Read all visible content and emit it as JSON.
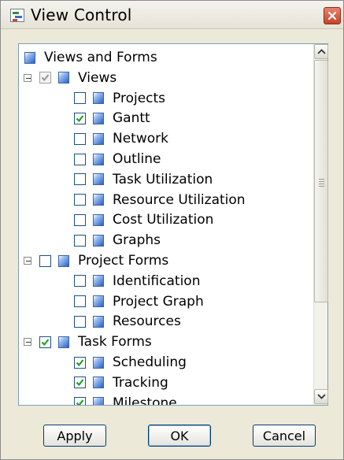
{
  "window": {
    "title": "View Control"
  },
  "tree": [
    {
      "label": "Views and Forms",
      "level": 0,
      "has_checkbox": false,
      "has_expander": false
    },
    {
      "label": "Views",
      "level": 0,
      "has_checkbox": true,
      "checked": true,
      "disabled": true,
      "has_expander": true
    },
    {
      "label": "Projects",
      "level": 1,
      "has_checkbox": true,
      "checked": false
    },
    {
      "label": "Gantt",
      "level": 1,
      "has_checkbox": true,
      "checked": true
    },
    {
      "label": "Network",
      "level": 1,
      "has_checkbox": true,
      "checked": false
    },
    {
      "label": "Outline",
      "level": 1,
      "has_checkbox": true,
      "checked": false
    },
    {
      "label": "Task Utilization",
      "level": 1,
      "has_checkbox": true,
      "checked": false
    },
    {
      "label": "Resource Utilization",
      "level": 1,
      "has_checkbox": true,
      "checked": false
    },
    {
      "label": "Cost Utilization",
      "level": 1,
      "has_checkbox": true,
      "checked": false
    },
    {
      "label": "Graphs",
      "level": 1,
      "has_checkbox": true,
      "checked": false
    },
    {
      "label": "Project Forms",
      "level": 0,
      "has_checkbox": true,
      "checked": false,
      "has_expander": true
    },
    {
      "label": "Identification",
      "level": 1,
      "has_checkbox": true,
      "checked": false
    },
    {
      "label": "Project Graph",
      "level": 1,
      "has_checkbox": true,
      "checked": false
    },
    {
      "label": "Resources",
      "level": 1,
      "has_checkbox": true,
      "checked": false
    },
    {
      "label": "Task Forms",
      "level": 0,
      "has_checkbox": true,
      "checked": true,
      "has_expander": true
    },
    {
      "label": "Scheduling",
      "level": 1,
      "has_checkbox": true,
      "checked": true
    },
    {
      "label": "Tracking",
      "level": 1,
      "has_checkbox": true,
      "checked": true
    },
    {
      "label": "Milestone",
      "level": 1,
      "has_checkbox": true,
      "checked": true
    }
  ],
  "buttons": {
    "apply": "Apply",
    "ok": "OK",
    "cancel": "Cancel"
  },
  "colors": {
    "check": "#21a121",
    "accent": "#2a5fc4",
    "close": "#c7432a"
  }
}
